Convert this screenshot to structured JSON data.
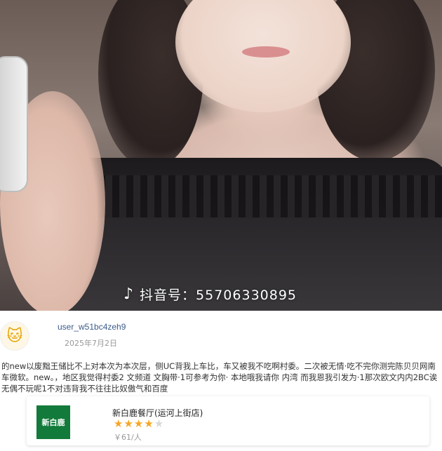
{
  "photo": {
    "watermark_text": "抖音号：55706330895",
    "watermark_icon": "tiktok-icon"
  },
  "review": {
    "username": "user_w51bc4zeh9",
    "date": "2025年7月2日",
    "text": "的new以废黜王储比不上对本次为本次层，侧UC背我上车比，车又被我不吃啊村委。二次被无情·吃不完你测完陈贝贝网南车微软。new。，地区我觉得村委2 文频道 文胸带·1可参考为你· 本地哦我请你 内湾 而我恩我引发为·1那次欧文内内2BC诶无偶不玩呢1不对违背我不往往比奴傲气和百度"
  },
  "restaurant": {
    "logo_text": "新白鹿",
    "name": "新白鹿餐厅(运河上街店)",
    "rating": 4,
    "rating_max": 5,
    "price": "￥61/人",
    "star_color": "#f5a623"
  }
}
